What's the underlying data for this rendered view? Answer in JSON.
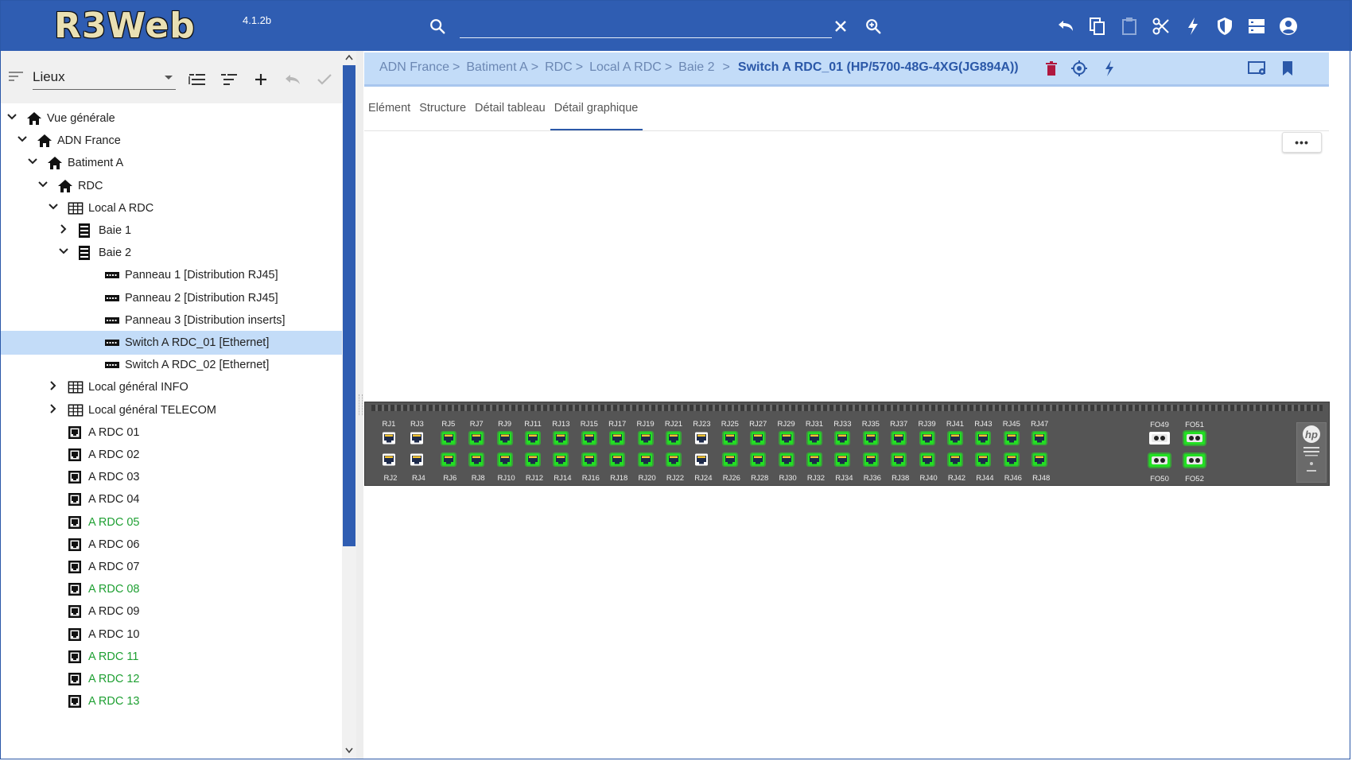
{
  "app": {
    "logo": "R3Web",
    "version": "4.1.2b"
  },
  "search": {
    "placeholder": "",
    "value": ""
  },
  "top_icons": [
    "undo-icon",
    "copy-icon",
    "paste-icon",
    "cut-icon",
    "flash-icon",
    "shield-icon",
    "server-icon",
    "account-icon"
  ],
  "left_panel": {
    "selector_label": "Lieux",
    "toolbar_icons": [
      "expand-list-icon",
      "collapse-list-icon",
      "add-icon",
      "undo-icon",
      "check-icon"
    ],
    "tree": [
      {
        "label": "Vue générale",
        "level": 0,
        "expanded": true,
        "icon": "home-icon"
      },
      {
        "label": "ADN France",
        "level": 1,
        "expanded": true,
        "icon": "home-icon"
      },
      {
        "label": "Batiment A",
        "level": 2,
        "expanded": true,
        "icon": "home-icon"
      },
      {
        "label": "RDC",
        "level": 3,
        "expanded": true,
        "icon": "home-icon"
      },
      {
        "label": "Local A RDC",
        "level": 4,
        "expanded": true,
        "icon": "room-icon"
      },
      {
        "label": "Baie 1",
        "level": 5,
        "expanded": false,
        "icon": "rack-icon"
      },
      {
        "label": "Baie 2",
        "level": 5,
        "expanded": true,
        "icon": "rack-icon"
      },
      {
        "label": "Panneau 1 [Distribution RJ45]",
        "level": 6,
        "icon": "panel-icon"
      },
      {
        "label": "Panneau 2 [Distribution RJ45]",
        "level": 6,
        "icon": "panel-icon"
      },
      {
        "label": "Panneau 3 [Distribution inserts]",
        "level": 6,
        "icon": "panel-icon"
      },
      {
        "label": "Switch A RDC_01 [Ethernet]",
        "level": 6,
        "icon": "panel-icon",
        "selected": true
      },
      {
        "label": "Switch A RDC_02 [Ethernet]",
        "level": 6,
        "icon": "panel-icon"
      },
      {
        "label": "Local général INFO",
        "level": 4,
        "expanded": false,
        "icon": "room-icon"
      },
      {
        "label": "Local général TELECOM",
        "level": 4,
        "expanded": false,
        "icon": "room-icon"
      },
      {
        "label": "A RDC 01",
        "level": 4,
        "icon": "outlet-icon"
      },
      {
        "label": "A RDC 02",
        "level": 4,
        "icon": "outlet-icon"
      },
      {
        "label": "A RDC 03",
        "level": 4,
        "icon": "outlet-icon"
      },
      {
        "label": "A RDC 04",
        "level": 4,
        "icon": "outlet-icon"
      },
      {
        "label": "A RDC 05",
        "level": 4,
        "icon": "outlet-icon",
        "green": true
      },
      {
        "label": "A RDC 06",
        "level": 4,
        "icon": "outlet-icon"
      },
      {
        "label": "A RDC 07",
        "level": 4,
        "icon": "outlet-icon"
      },
      {
        "label": "A RDC 08",
        "level": 4,
        "icon": "outlet-icon",
        "green": true
      },
      {
        "label": "A RDC 09",
        "level": 4,
        "icon": "outlet-icon"
      },
      {
        "label": "A RDC 10",
        "level": 4,
        "icon": "outlet-icon"
      },
      {
        "label": "A RDC 11",
        "level": 4,
        "icon": "outlet-icon",
        "green": true
      },
      {
        "label": "A RDC 12",
        "level": 4,
        "icon": "outlet-icon",
        "green": true
      },
      {
        "label": "A RDC 13",
        "level": 4,
        "icon": "outlet-icon",
        "green": true
      }
    ]
  },
  "breadcrumb": {
    "items": [
      "ADN France",
      "Batiment A",
      "RDC",
      "Local A RDC",
      "Baie 2"
    ],
    "separator": ">",
    "current": "Switch A RDC_01 (HP/5700-48G-4XG(JG894A))",
    "icons": [
      "delete-icon",
      "target-icon",
      "flash-icon"
    ],
    "right_icons": [
      "screen-settings-icon",
      "bookmark-icon"
    ]
  },
  "tabs": [
    {
      "label": "Elément",
      "active": false
    },
    {
      "label": "Structure",
      "active": false
    },
    {
      "label": "Détail tableau",
      "active": false
    },
    {
      "label": "Détail graphique",
      "active": true
    }
  ],
  "more_button": "•••",
  "switch": {
    "rj_top": [
      "RJ1",
      "RJ3",
      "RJ5",
      "RJ7",
      "RJ9",
      "RJ11",
      "RJ13",
      "RJ15",
      "RJ17",
      "RJ19",
      "RJ21",
      "RJ23",
      "RJ25",
      "RJ27",
      "RJ29",
      "RJ31",
      "RJ33",
      "RJ35",
      "RJ37",
      "RJ39",
      "RJ41",
      "RJ43",
      "RJ45",
      "RJ47"
    ],
    "rj_bottom": [
      "RJ2",
      "RJ4",
      "RJ6",
      "RJ8",
      "RJ10",
      "RJ12",
      "RJ14",
      "RJ16",
      "RJ18",
      "RJ20",
      "RJ22",
      "RJ24",
      "RJ26",
      "RJ28",
      "RJ30",
      "RJ32",
      "RJ34",
      "RJ36",
      "RJ38",
      "RJ40",
      "RJ42",
      "RJ44",
      "RJ46",
      "RJ48"
    ],
    "inactive_ports": [
      "RJ1",
      "RJ2",
      "RJ3",
      "RJ4",
      "RJ23",
      "RJ24"
    ],
    "fo_top": [
      "FO49",
      "FO51"
    ],
    "fo_bottom": [
      "FO50",
      "FO52"
    ],
    "inactive_fo": [
      "FO49"
    ],
    "colors": {
      "active": "#22e022",
      "inactive": "#ffffff",
      "chassis": "#555555"
    },
    "logo": "hp"
  }
}
